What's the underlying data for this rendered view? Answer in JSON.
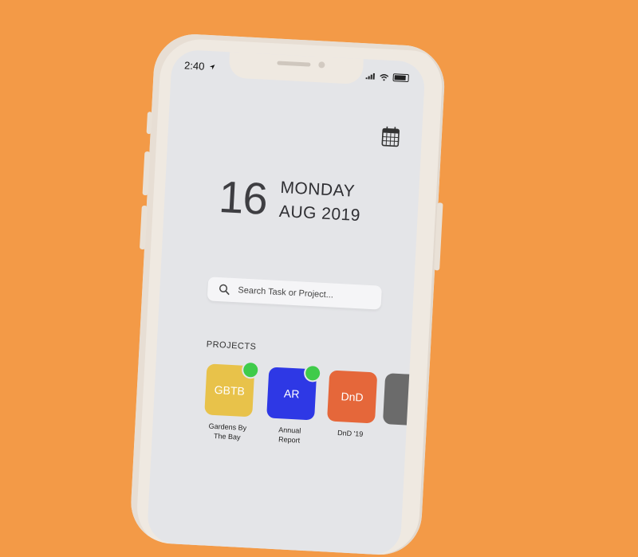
{
  "status_bar": {
    "time": "2:40"
  },
  "date": {
    "day": "16",
    "weekday": "MONDAY",
    "month_year": "AUG 2019"
  },
  "search": {
    "placeholder": "Search Task or Project..."
  },
  "projects": {
    "label": "PROJECTS",
    "items": [
      {
        "abbr": "GBTB",
        "name_line1": "Gardens By",
        "name_line2": "The Bay",
        "color": "#E8C24A",
        "notification": true
      },
      {
        "abbr": "AR",
        "name_line1": "Annual",
        "name_line2": "Report",
        "color": "#2E38E5",
        "notification": true
      },
      {
        "abbr": "DnD",
        "name_line1": "DnD '19",
        "name_line2": "",
        "color": "#E5673A",
        "notification": false
      },
      {
        "abbr": "",
        "name_line1": "",
        "name_line2": "",
        "color": "#6B6B6B",
        "notification": false
      }
    ]
  },
  "icons": {
    "calendar": "calendar-icon",
    "search": "search-icon",
    "location": "location-arrow-icon",
    "signal": "signal-icon",
    "wifi": "wifi-icon",
    "battery": "battery-icon"
  },
  "colors": {
    "background": "#F39A47",
    "screen": "#E4E5E8",
    "phone_body": "#EFE9E1"
  }
}
